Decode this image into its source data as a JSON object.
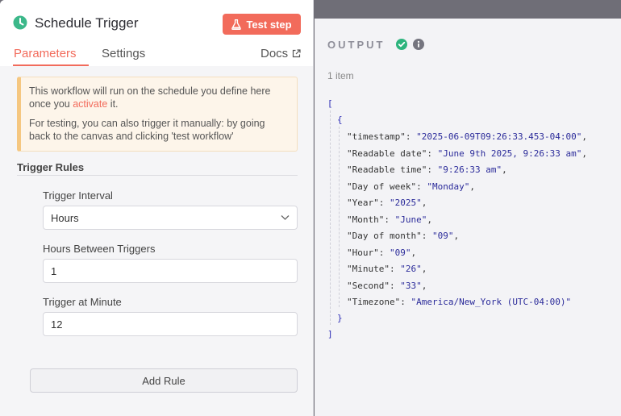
{
  "node": {
    "title": "Schedule Trigger",
    "test_step_label": "Test step",
    "accent_color": "#f26b5b",
    "icon": "clock-icon"
  },
  "tabs": [
    {
      "label": "Parameters",
      "active": true
    },
    {
      "label": "Settings",
      "active": false
    }
  ],
  "docs_label": "Docs",
  "notice": {
    "line1_before": "This workflow will run on the schedule you define here once you ",
    "link": "activate",
    "line1_after": " it.",
    "line2": "For testing, you can also trigger it manually: by going back to the canvas and clicking 'test workflow'"
  },
  "trigger_rules": {
    "section_title": "Trigger Rules",
    "fields": [
      {
        "label": "Trigger Interval",
        "value": "Hours",
        "type": "select"
      },
      {
        "label": "Hours Between Triggers",
        "value": "1",
        "type": "number"
      },
      {
        "label": "Trigger at Minute",
        "value": "12",
        "type": "number"
      }
    ],
    "add_rule_label": "Add Rule"
  },
  "output": {
    "title": "OUTPUT",
    "status_color": "#2db47d",
    "item_count": "1 item",
    "open_bracket": "[",
    "open_brace": "{",
    "close_brace": "}",
    "close_bracket": "]",
    "entries": [
      {
        "key": "\"timestamp\"",
        "value": "\"2025-06-09T09:26:33.453-04:00\""
      },
      {
        "key": "\"Readable date\"",
        "value": "\"June 9th 2025, 9:26:33 am\""
      },
      {
        "key": "\"Readable time\"",
        "value": "\"9:26:33 am\""
      },
      {
        "key": "\"Day of week\"",
        "value": "\"Monday\""
      },
      {
        "key": "\"Year\"",
        "value": "\"2025\""
      },
      {
        "key": "\"Month\"",
        "value": "\"June\""
      },
      {
        "key": "\"Day of month\"",
        "value": "\"09\""
      },
      {
        "key": "\"Hour\"",
        "value": "\"09\""
      },
      {
        "key": "\"Minute\"",
        "value": "\"26\""
      },
      {
        "key": "\"Second\"",
        "value": "\"33\""
      },
      {
        "key": "\"Timezone\"",
        "value": "\"America/New_York (UTC-04:00)\""
      }
    ]
  }
}
